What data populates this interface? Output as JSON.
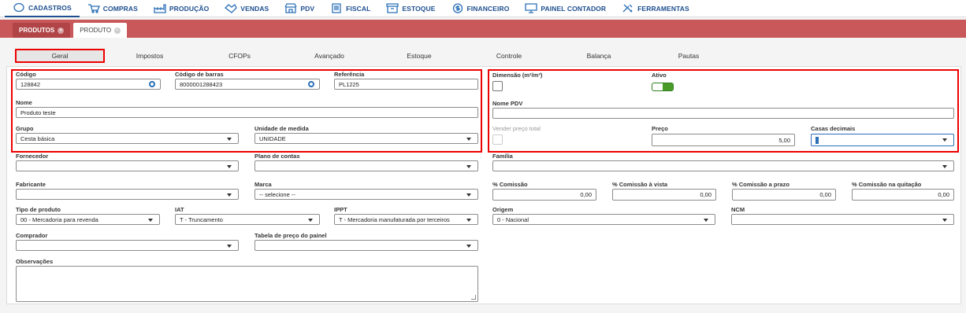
{
  "nav": [
    {
      "label": "CADASTROS",
      "icon": "circle-icon"
    },
    {
      "label": "COMPRAS",
      "icon": "cart-icon"
    },
    {
      "label": "PRODUÇÃO",
      "icon": "factory-icon"
    },
    {
      "label": "VENDAS",
      "icon": "handshake-icon"
    },
    {
      "label": "PDV",
      "icon": "store-icon"
    },
    {
      "label": "FISCAL",
      "icon": "document-icon"
    },
    {
      "label": "ESTOQUE",
      "icon": "box-icon"
    },
    {
      "label": "FINANCEIRO",
      "icon": "dollar-icon"
    },
    {
      "label": "PAINEL CONTADOR",
      "icon": "screen-icon"
    },
    {
      "label": "FERRAMENTAS",
      "icon": "tools-icon"
    }
  ],
  "doc_tabs": [
    {
      "label": "PRODUTOS"
    },
    {
      "label": "PRODUTO"
    }
  ],
  "subtabs": [
    "Geral",
    "Impostos",
    "CFOPs",
    "Avançado",
    "Estoque",
    "Controle",
    "Balança",
    "Pautas"
  ],
  "form": {
    "codigo": {
      "label": "Código",
      "value": "128842"
    },
    "codigo_barras": {
      "label": "Código de barras",
      "value": "8000001288423"
    },
    "referencia": {
      "label": "Referência",
      "value": "PL1225"
    },
    "nome": {
      "label": "Nome",
      "value": "Produto teste"
    },
    "grupo": {
      "label": "Grupo",
      "value": "Cesta básica"
    },
    "unidade": {
      "label": "Unidade de medida",
      "value": "UNIDADE"
    },
    "fornecedor": {
      "label": "Fornecedor",
      "value": ""
    },
    "plano_contas": {
      "label": "Plano de contas",
      "value": ""
    },
    "fabricante": {
      "label": "Fabricante",
      "value": ""
    },
    "marca": {
      "label": "Marca",
      "value": "-- selecione --"
    },
    "tipo_produto": {
      "label": "Tipo de produto",
      "value": "00 - Mercadoria para revenda"
    },
    "iat": {
      "label": "IAT",
      "value": "T - Truncamento"
    },
    "ippt": {
      "label": "IPPT",
      "value": "T - Mercadoria manufaturada por terceiros"
    },
    "comprador": {
      "label": "Comprador",
      "value": ""
    },
    "tabela_preco": {
      "label": "Tabela de preço do painel",
      "value": ""
    },
    "observacoes": {
      "label": "Observações",
      "value": ""
    },
    "dimensao": {
      "label": "Dimensão (m²/m³)"
    },
    "ativo": {
      "label": "Ativo"
    },
    "nome_pdv": {
      "label": "Nome PDV",
      "value": ""
    },
    "vender_preco_total": {
      "label": "Vender preço total"
    },
    "preco": {
      "label": "Preço",
      "value": "5,00"
    },
    "casas_decimais": {
      "label": "Casas decimais",
      "value": ""
    },
    "familia": {
      "label": "Família",
      "value": ""
    },
    "comissao": {
      "label": "% Comissão",
      "value": "0,00"
    },
    "comissao_vista": {
      "label": "% Comissão à vista",
      "value": "0,00"
    },
    "comissao_prazo": {
      "label": "% Comissão a prazo",
      "value": "0,00"
    },
    "comissao_quitacao": {
      "label": "% Comissão na quitação",
      "value": "0,00"
    },
    "origem": {
      "label": "Origem",
      "value": "0 - Nacional"
    },
    "ncm": {
      "label": "NCM",
      "value": ""
    }
  },
  "colors": {
    "nav_text": "#1e4f8f",
    "tabbar": "#c9585a",
    "highlight": "#e00000",
    "toggle_on": "#4a9a2a"
  }
}
